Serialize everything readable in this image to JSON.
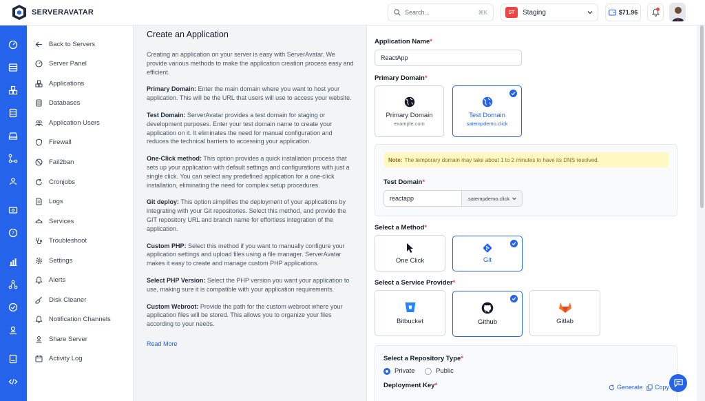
{
  "brand": {
    "name": "SERVERAVATAR"
  },
  "topbar": {
    "search_placeholder": "Search...",
    "search_shortcut": "⌘K",
    "server_badge": "ST",
    "server_name": "Staging",
    "balance": "$71.96"
  },
  "sidebar": {
    "items": [
      {
        "label": "Back to Servers",
        "icon": "arrow-left-icon"
      },
      {
        "label": "Server Panel",
        "icon": "gauge-icon"
      },
      {
        "label": "Applications",
        "icon": "cubes-icon"
      },
      {
        "label": "Databases",
        "icon": "database-icon"
      },
      {
        "label": "Application Users",
        "icon": "users-icon"
      },
      {
        "label": "Firewall",
        "icon": "shield-icon"
      },
      {
        "label": "Fail2ban",
        "icon": "ban-icon"
      },
      {
        "label": "Cronjobs",
        "icon": "refresh-icon"
      },
      {
        "label": "Logs",
        "icon": "file-icon"
      },
      {
        "label": "Services",
        "icon": "services-icon"
      },
      {
        "label": "Troubleshoot",
        "icon": "stethoscope-icon"
      },
      {
        "label": "Settings",
        "icon": "gear-icon"
      },
      {
        "label": "Alerts",
        "icon": "bell-icon"
      },
      {
        "label": "Disk Cleaner",
        "icon": "broom-icon"
      },
      {
        "label": "Notification Channels",
        "icon": "bell-icon"
      },
      {
        "label": "Share Server",
        "icon": "share-icon"
      },
      {
        "label": "Activity Log",
        "icon": "calendar-icon"
      }
    ]
  },
  "info": {
    "title": "Create an Application",
    "intro": "Creating an application on your server is easy with ServerAvatar. We provide various methods to make the application creation process easy and efficient.",
    "sections": [
      {
        "term": "Primary Domain:",
        "text": " Enter the main domain where you want to host your application. This will be the URL that users will use to access your website."
      },
      {
        "term": "Test Domain:",
        "text": " ServerAvatar provides a test domain for staging or development purposes. Enter your test domain name to create your application on it. It eliminates the need for manual configuration and reduces the technical barriers to accessing your application."
      },
      {
        "term": "One-Click method:",
        "text": " This option provides a quick installation process that sets up your application with default settings and configurations with just a single click. You can select any predefined application for a one-click installation, eliminating the need for complex setup procedures."
      },
      {
        "term": "Git deploy:",
        "text": " This option simplifies the deployment of your applications by integrating with your Git repositories. Select this method, and provide the GIT repository URL and branch name for effortless integration of the application."
      },
      {
        "term": "Custom PHP:",
        "text": " Select this method if you want to manually configure your application settings and upload files using a file manager. ServerAvatar makes it easy to create and manage custom PHP applications."
      },
      {
        "term": "Select PHP Version:",
        "text": " Select the PHP version you want your application to use, making sure it is compatible with your application requirements."
      },
      {
        "term": "Custom Webroot:",
        "text": " Provide the path for the custom webroot where your application files will be stored. This allows you to organize your files according to your needs."
      }
    ],
    "read_more": "Read More"
  },
  "form": {
    "app_name_label": "Application Name",
    "app_name_value": "ReactApp",
    "primary_domain_label": "Primary Domain",
    "domain_options": [
      {
        "title": "Primary Domain",
        "sub": "example.com",
        "selected": false
      },
      {
        "title": "Test Domain",
        "sub": "satempdemo.click",
        "selected": true
      }
    ],
    "note_label": "Note:",
    "note_text": "The temporary domain may take about 1 to 2 minutes to have its DNS resolved.",
    "test_domain_label": "Test Domain",
    "test_domain_value": "reactapp",
    "test_domain_suffix": ".satempdemo.click",
    "method_label": "Select a Method",
    "methods": [
      {
        "title": "One Click",
        "selected": false
      },
      {
        "title": "Git",
        "selected": true
      }
    ],
    "provider_label": "Select a Service Provider",
    "providers": [
      {
        "title": "Bitbucket",
        "selected": false
      },
      {
        "title": "Github",
        "selected": true
      },
      {
        "title": "Gitlab",
        "selected": false
      }
    ],
    "repo_type_label": "Select a Repository Type",
    "repo_types": [
      {
        "title": "Private",
        "selected": true
      },
      {
        "title": "Public",
        "selected": false
      }
    ],
    "deploy_key_label": "Deployment Key",
    "generate_label": "Generate",
    "copy_label": "Copy",
    "required_mark": "*"
  },
  "colors": {
    "accent": "#2563eb",
    "rail": "#2563eb",
    "note_bg": "#fef9c3"
  }
}
